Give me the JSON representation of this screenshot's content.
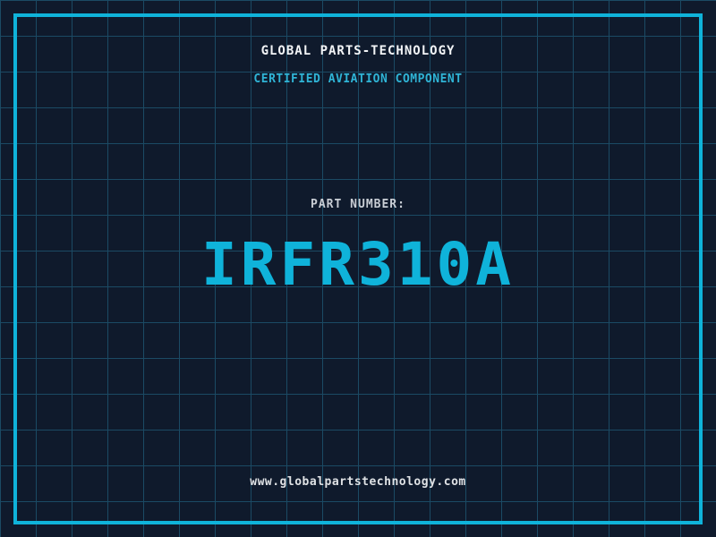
{
  "header": {
    "company_name": "GLOBAL PARTS-TECHNOLOGY",
    "subtitle": "CERTIFIED AVIATION COMPONENT"
  },
  "part": {
    "label": "PART NUMBER:",
    "number": "IRFR310A"
  },
  "footer": {
    "website": "www.globalpartstechnology.com"
  },
  "colors": {
    "background": "#0f1a2c",
    "grid": "#1b4a64",
    "accent": "#0fb3da",
    "subtitle": "#2fb4d6",
    "label": "#c9ced5",
    "heading": "#f2f4f6",
    "url": "#dfe2e5"
  }
}
